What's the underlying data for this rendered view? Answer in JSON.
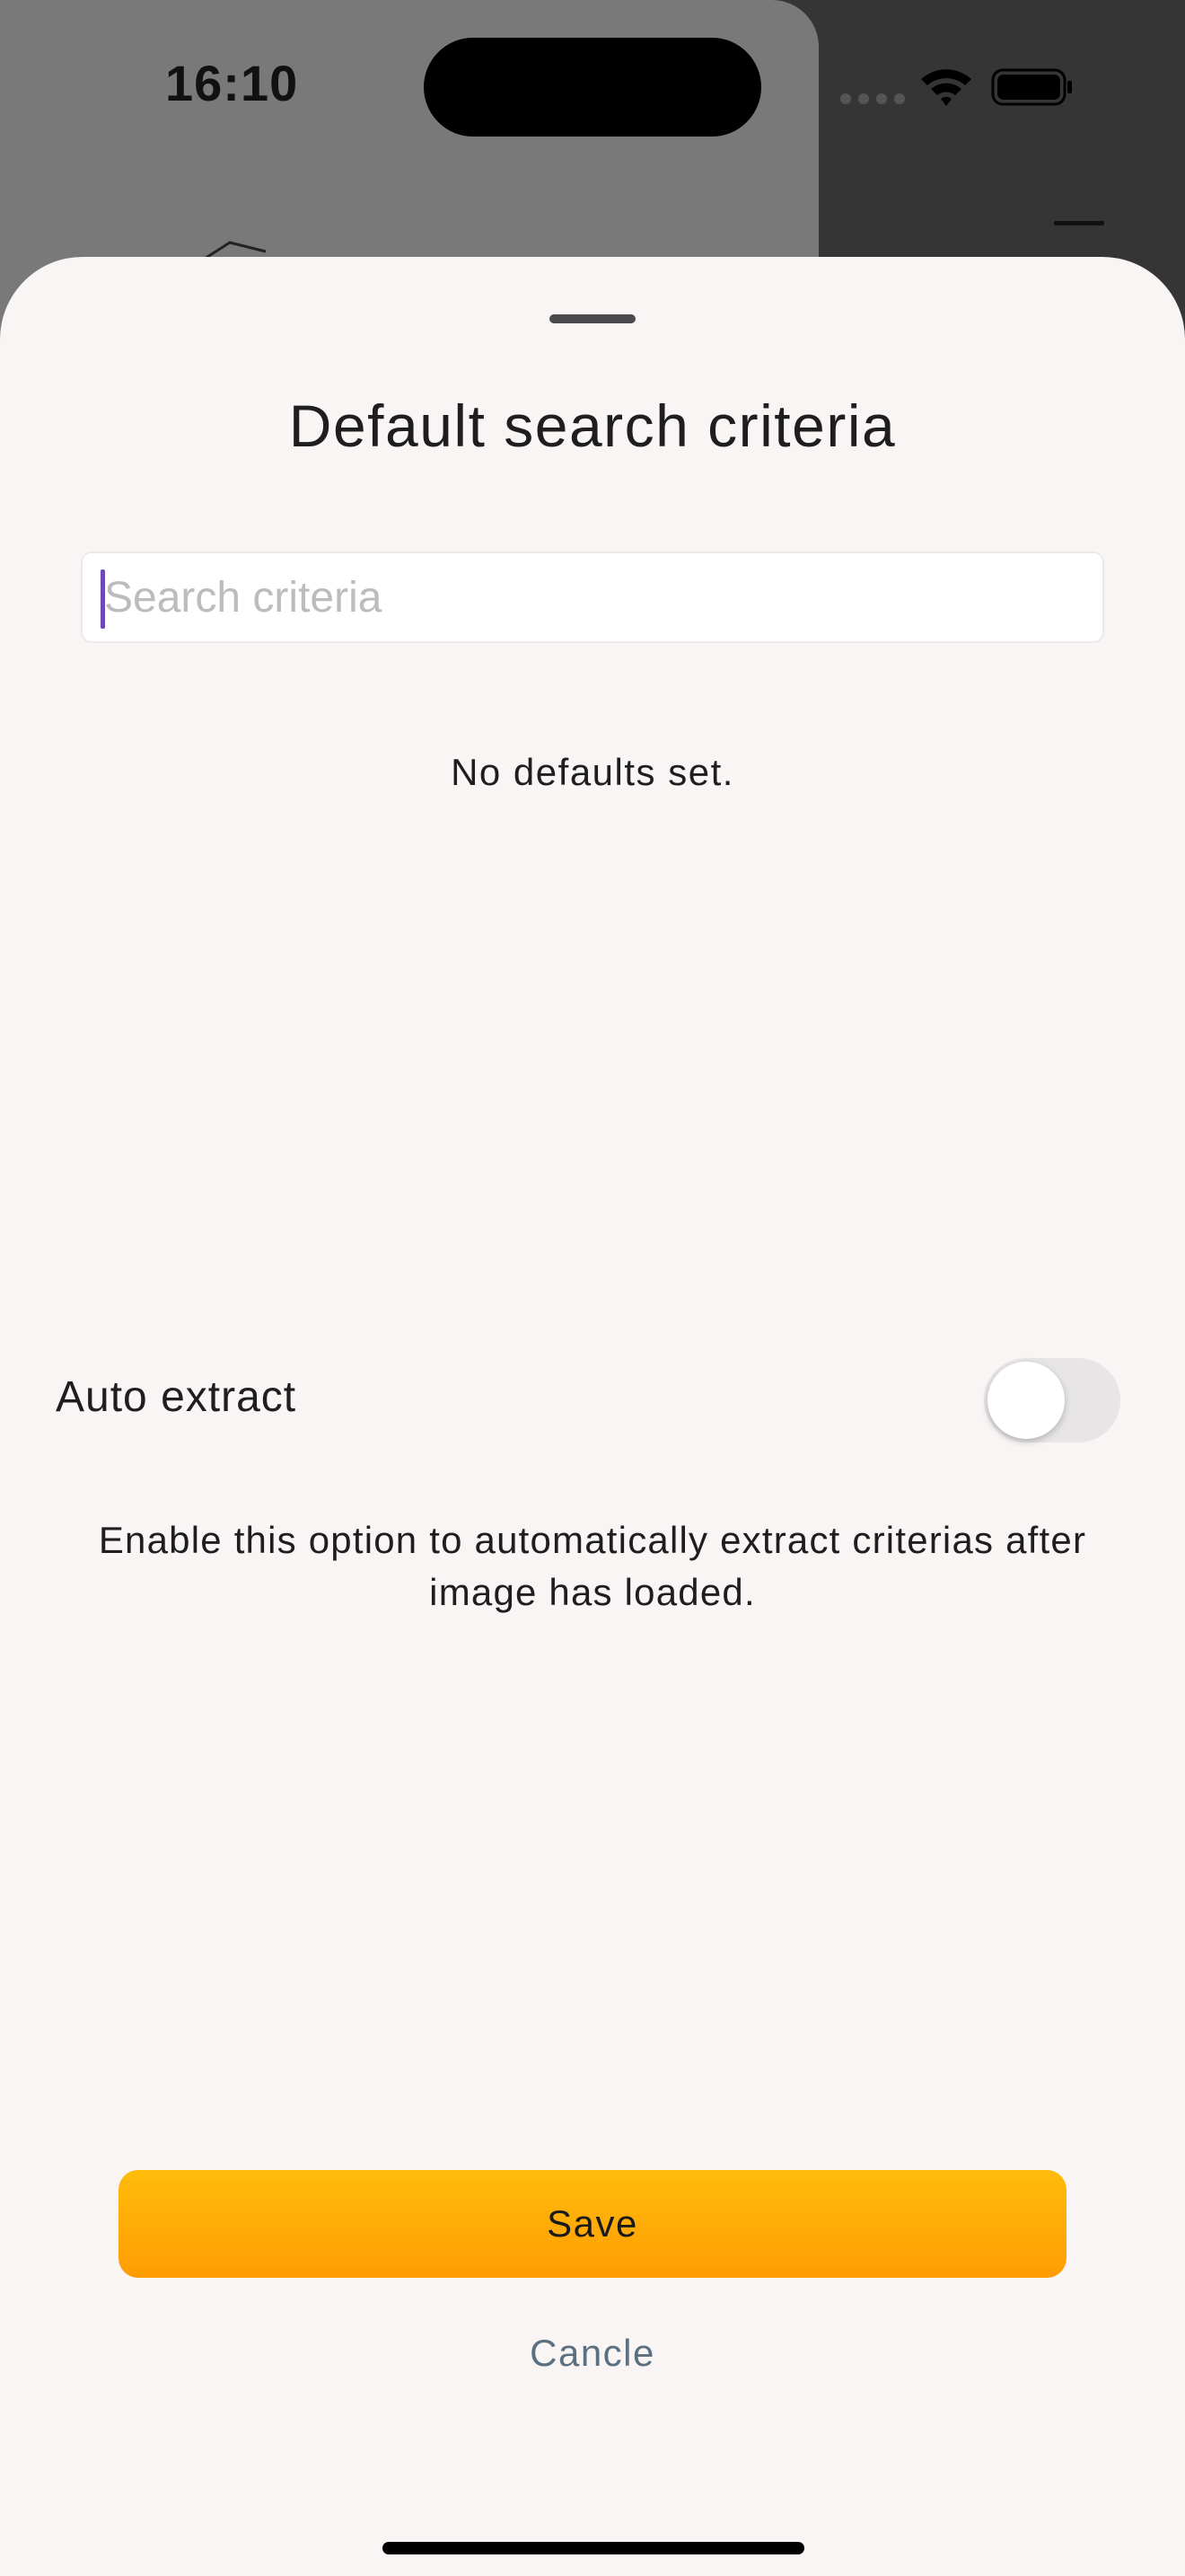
{
  "status_bar": {
    "time": "16:10"
  },
  "sheet": {
    "title": "Default search criteria",
    "search": {
      "value": "",
      "placeholder": "Search criteria"
    },
    "empty_message": "No defaults set.",
    "auto_extract": {
      "label": "Auto extract",
      "enabled": false
    },
    "help_text": "Enable this option to automatically extract criterias after image has loaded.",
    "save_label": "Save",
    "cancel_label": "Cancle"
  },
  "colors": {
    "accent_caret": "#6c4ab6",
    "save_gradient_top": "#ffbc0a",
    "save_gradient_bottom": "#ff9c04",
    "cancel_text": "#5b7182",
    "sheet_background": "#f8f5f4"
  },
  "icons": [
    "wifi-icon",
    "battery-icon",
    "menu-icon",
    "logo-icon",
    "signal-dots-icon"
  ]
}
